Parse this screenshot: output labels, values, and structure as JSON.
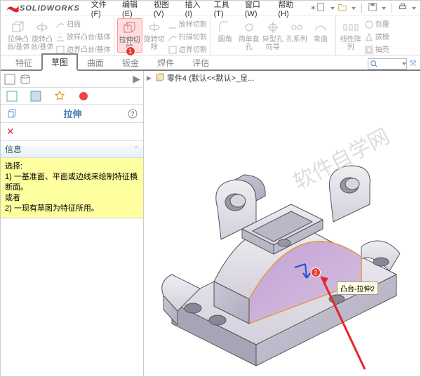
{
  "app": {
    "name": "SOLIDWORKS"
  },
  "menubar": {
    "items": [
      {
        "label": "文件(F)"
      },
      {
        "label": "编辑(E)"
      },
      {
        "label": "视图(V)"
      },
      {
        "label": "插入(I)"
      },
      {
        "label": "工具(T)"
      },
      {
        "label": "窗口(W)"
      },
      {
        "label": "帮助(H)"
      }
    ]
  },
  "ribbon": {
    "g1": {
      "big1": "拉伸凸台/基体",
      "big2": "旋转凸台/基体",
      "s1": "扫描",
      "s2": "放样凸台/基体",
      "s3": "边界凸台/基体"
    },
    "g2": {
      "big1": "拉伸切除",
      "big2": "旋转切除",
      "s1": "放样切割",
      "s2": "扫描切割",
      "s3": "边界切割"
    },
    "g3": {
      "big1": "圆角",
      "big2": "简单直孔",
      "big3": "异型孔向导",
      "big4": "孔系列",
      "big5": "弯曲"
    },
    "g4": {
      "big1": "线性阵列",
      "s1": "包覆",
      "s2": "拔模",
      "s3": "抽壳"
    }
  },
  "tabs": {
    "items": [
      {
        "label": "特征",
        "muted": true
      },
      {
        "label": "草图",
        "active": true
      },
      {
        "label": "曲面",
        "muted": true
      },
      {
        "label": "钣金",
        "muted": true
      },
      {
        "label": "焊件",
        "muted": true
      },
      {
        "label": "评估",
        "muted": true
      }
    ]
  },
  "panel": {
    "title": "拉伸",
    "info_header": "信息",
    "info_text": "选择:\n1) 一基准面、平面或边线来绘制特征横断面。\n或者\n2) 一现有草图为特征所用。"
  },
  "breadcrumb": {
    "text": "零件4  (默认<<默认>_显..."
  },
  "annotations": {
    "badge1": "1",
    "badge2": "2",
    "tooltip": "凸台-拉伸2"
  },
  "watermark": "软件自学网"
}
